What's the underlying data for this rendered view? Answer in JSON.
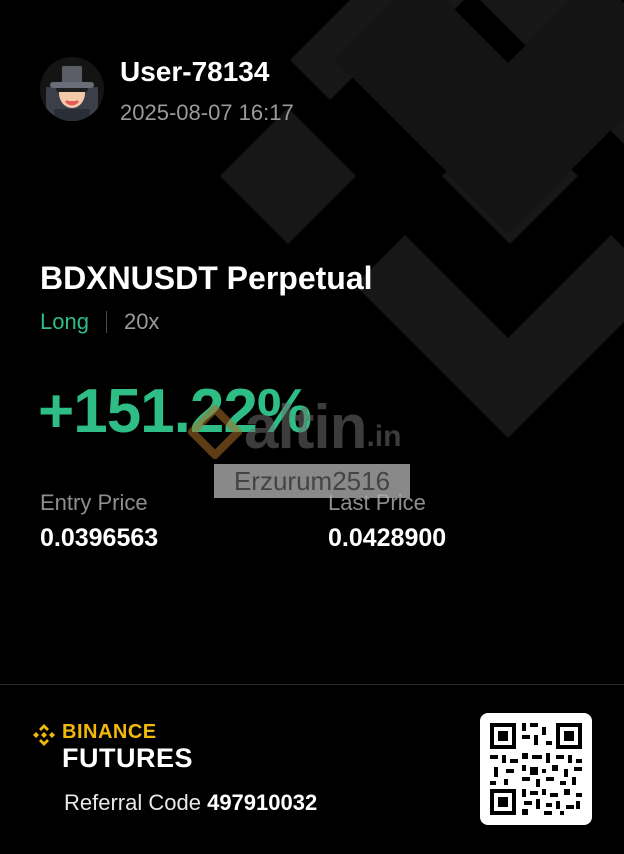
{
  "user": {
    "name": "User-78134",
    "timestamp": "2025-08-07 16:17"
  },
  "position": {
    "symbol": "BDXNUSDT Perpetual",
    "side": "Long",
    "leverage": "20x",
    "pnl_percent": "+151.22%",
    "entry_label": "Entry Price",
    "entry_price": "0.0396563",
    "last_label": "Last Price",
    "last_price": "0.0428900"
  },
  "watermark": {
    "site": "altin",
    "tld": ".in",
    "tag": "Erzurum2516"
  },
  "footer": {
    "brand": "BINANCE",
    "product": "FUTURES",
    "referral_label": "Referral Code",
    "referral_code": "497910032"
  },
  "colors": {
    "background": "#000000",
    "profit_green": "#2ebd85",
    "brand_yellow": "#f0b90b",
    "muted_text": "#9a9a9a"
  },
  "icons": {
    "avatar": "user-avatar-icon",
    "brand": "binance-logo-icon",
    "qr": "qr-code-icon"
  }
}
